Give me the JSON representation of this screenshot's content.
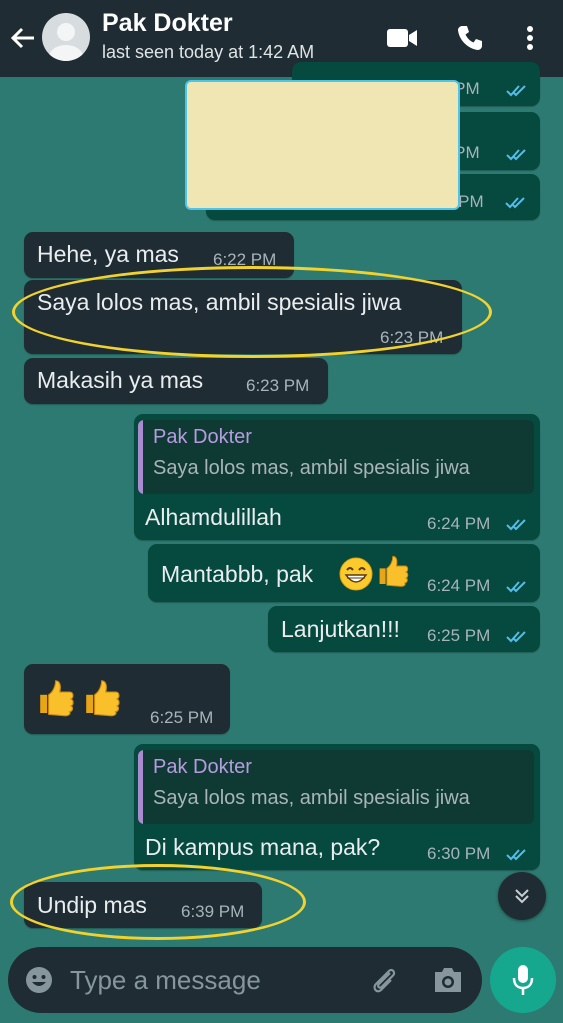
{
  "header": {
    "contact_name": "Pak Dokter",
    "last_seen": "last seen today at 1:42 AM"
  },
  "hidden_messages": [
    {
      "time_partial": "1 PM"
    },
    {
      "time_partial": "1 PM"
    },
    {
      "time_partial": "2 PM"
    }
  ],
  "messages": [
    {
      "direction": "incoming",
      "text": "Hehe, ya mas",
      "time": "6:22 PM"
    },
    {
      "direction": "incoming",
      "text": "Saya lolos mas, ambil spesialis jiwa",
      "time": "6:23 PM"
    },
    {
      "direction": "incoming",
      "text": "Makasih ya mas",
      "time": "6:23 PM"
    },
    {
      "direction": "outgoing",
      "quote_author": "Pak Dokter",
      "quote_text": "Saya lolos mas, ambil spesialis jiwa",
      "text": "Alhamdulillah",
      "time": "6:24 PM"
    },
    {
      "direction": "outgoing",
      "text": "Mantabbb, pak",
      "time": "6:24 PM"
    },
    {
      "direction": "outgoing",
      "text": "Lanjutkan!!!",
      "time": "6:25 PM"
    },
    {
      "direction": "incoming",
      "text": "",
      "time": "6:25 PM"
    },
    {
      "direction": "outgoing",
      "quote_author": "Pak Dokter",
      "quote_text": "Saya lolos mas, ambil spesialis jiwa",
      "text": "Di kampus mana, pak?",
      "time": "6:30 PM"
    },
    {
      "direction": "incoming",
      "text": "Undip mas",
      "time": "6:39 PM"
    }
  ],
  "input": {
    "placeholder": "Type a message"
  },
  "colors": {
    "background": "#2d7a72",
    "header": "#1f2c33",
    "incoming_bubble": "#1f2c33",
    "outgoing_bubble": "#05493f",
    "read_tick": "#53bdeb",
    "highlight": "#f2d22e",
    "mic_button": "#16a88f"
  },
  "icons": [
    "back-arrow-icon",
    "avatar-icon",
    "video-call-icon",
    "phone-icon",
    "more-icon",
    "read-tick-icon",
    "grin-emoji-icon",
    "thumbs-up-icon",
    "chevron-double-down-icon",
    "emoji-icon",
    "attach-icon",
    "camera-icon",
    "mic-icon"
  ]
}
